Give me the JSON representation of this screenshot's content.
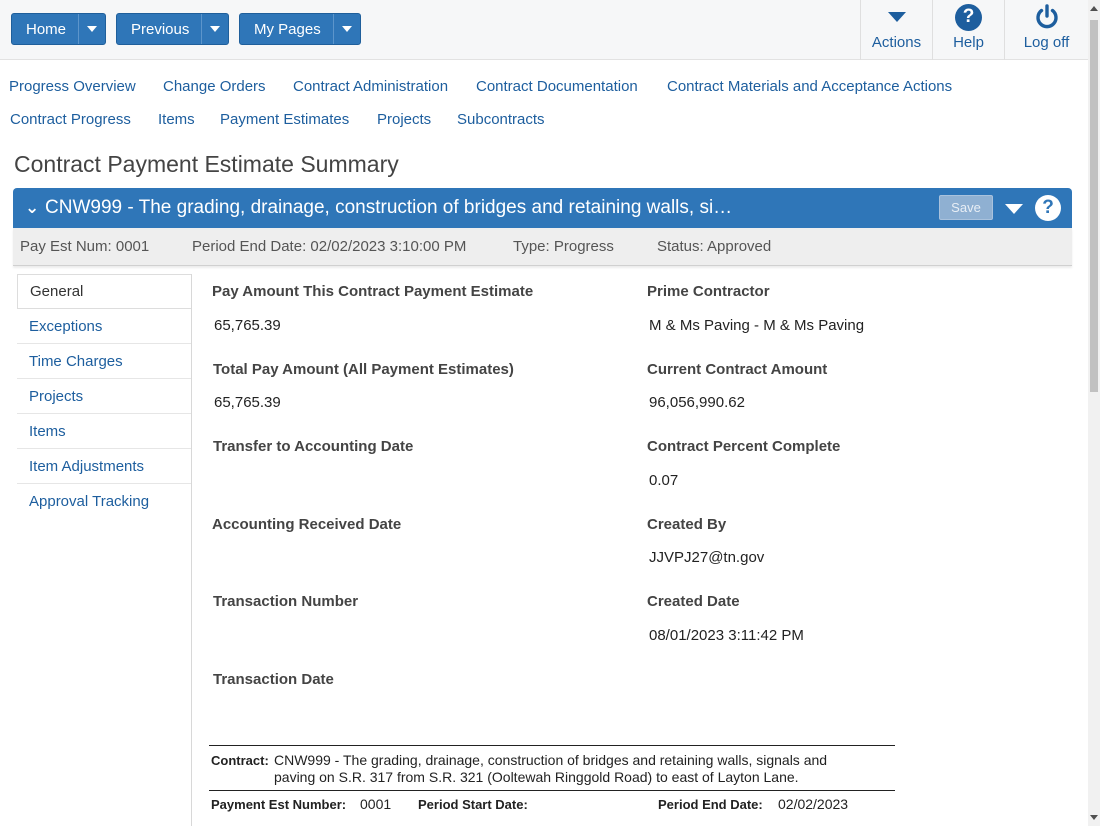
{
  "nav": {
    "home": "Home",
    "previous": "Previous",
    "my_pages": "My Pages"
  },
  "top_actions": {
    "actions": "Actions",
    "help": "Help",
    "logoff": "Log off"
  },
  "links_row1": [
    "Progress Overview",
    "Change Orders",
    "Contract Administration",
    "Contract Documentation",
    "Contract Materials and Acceptance Actions"
  ],
  "links_row2": [
    "Contract Progress",
    "Items",
    "Payment Estimates",
    "Projects",
    "Subcontracts"
  ],
  "page_title": "Contract Payment Estimate Summary",
  "bar": {
    "title": "CNW999 - The grading, drainage, construction of bridges and retaining walls, si…",
    "save": "Save"
  },
  "info": {
    "pay_est_num": "Pay Est Num: 0001",
    "period_end": "Period End Date: 02/02/2023 3:10:00 PM",
    "type": "Type: Progress",
    "status": "Status: Approved"
  },
  "sidebar": [
    "General",
    "Exceptions",
    "Time Charges",
    "Projects",
    "Items",
    "Item Adjustments",
    "Approval Tracking"
  ],
  "fields": {
    "pay_amount_label": "Pay Amount This Contract Payment Estimate",
    "pay_amount_value": "65,765.39",
    "total_pay_label": "Total Pay Amount (All Payment Estimates)",
    "total_pay_value": "65,765.39",
    "transfer_label": "Transfer to Accounting Date",
    "acct_received_label": "Accounting Received Date",
    "transaction_number_label": "Transaction Number",
    "transaction_date_label": "Transaction Date",
    "prime_label": "Prime Contractor",
    "prime_value": "M & Ms Paving - M & Ms Paving",
    "current_amount_label": "Current Contract Amount",
    "current_amount_value": "96,056,990.62",
    "percent_label": "Contract Percent Complete",
    "percent_value": "0.07",
    "created_by_label": "Created By",
    "created_by_value": "JJVPJ27@tn.gov",
    "created_date_label": "Created Date",
    "created_date_value": "08/01/2023 3:11:42 PM"
  },
  "report": {
    "contract_label": "Contract:",
    "contract_line1": "CNW999 - The grading, drainage, construction of bridges and retaining walls, signals and",
    "contract_line2": "paving on S.R. 317 from S.R. 321 (Ooltewah Ringgold Road) to east of Layton Lane.",
    "pay_est_label": "Payment Est Number:",
    "pay_est_value": "0001",
    "period_start_label": "Period Start Date:",
    "period_end_label": "Period End Date:",
    "period_end_value": "02/02/2023"
  }
}
